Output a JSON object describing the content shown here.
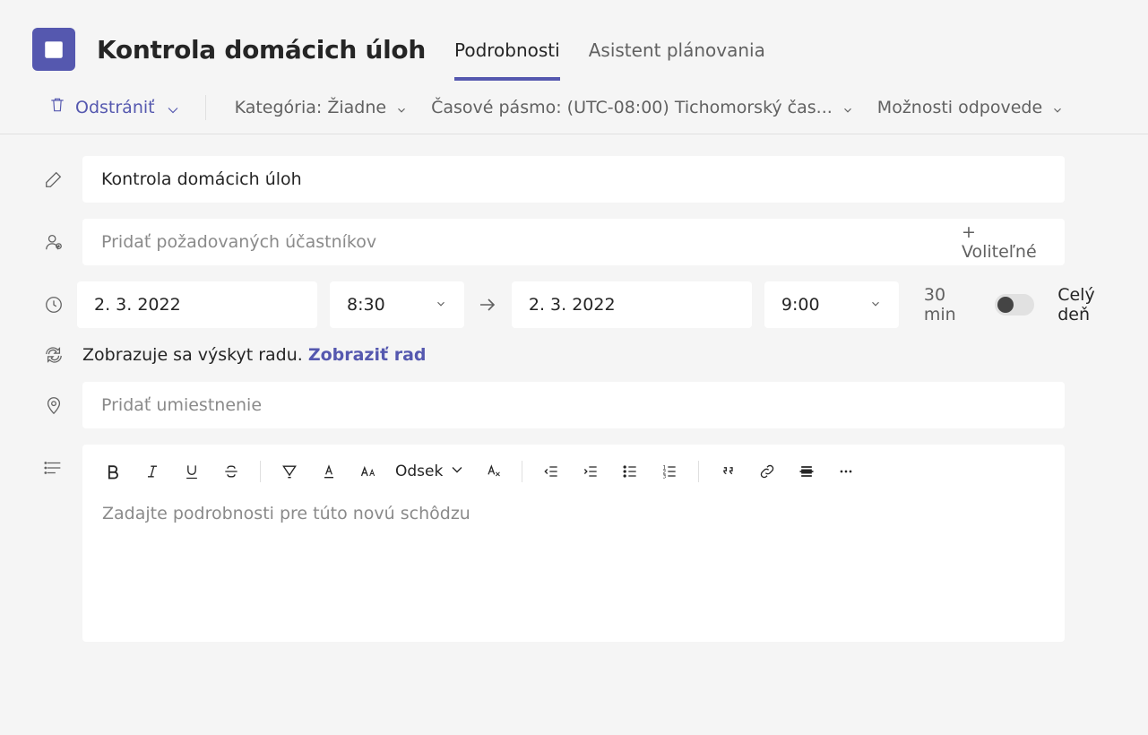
{
  "header": {
    "title": "Kontrola domácich úloh",
    "tabs": [
      {
        "label": "Podrobnosti",
        "active": true
      },
      {
        "label": "Asistent plánovania",
        "active": false
      }
    ]
  },
  "option_bar": {
    "delete_label": "Odstrániť",
    "category_label": "Kategória: Žiadne",
    "timezone_label": "Časové pásmo: (UTC-08:00) Tichomorský čas...",
    "response_options_label": "Možnosti odpovede"
  },
  "form": {
    "title_value": "Kontrola domácich úloh",
    "attendees_placeholder": "Pridať požadovaných účastníkov",
    "attendees_optional_link": "+ Voliteľné",
    "start_date": "2. 3. 2022",
    "start_time": "8:30",
    "end_date": "2. 3. 2022",
    "end_time": "9:00",
    "duration_label": "30 min",
    "all_day_label": "Celý deň",
    "all_day_value": false,
    "recurrence_text": "Zobrazuje sa výskyt radu.",
    "recurrence_link": "Zobraziť rad",
    "location_placeholder": "Pridať umiestnenie",
    "editor_paragraph_label": "Odsek",
    "editor_placeholder": "Zadajte podrobnosti pre túto novú schôdzu"
  }
}
